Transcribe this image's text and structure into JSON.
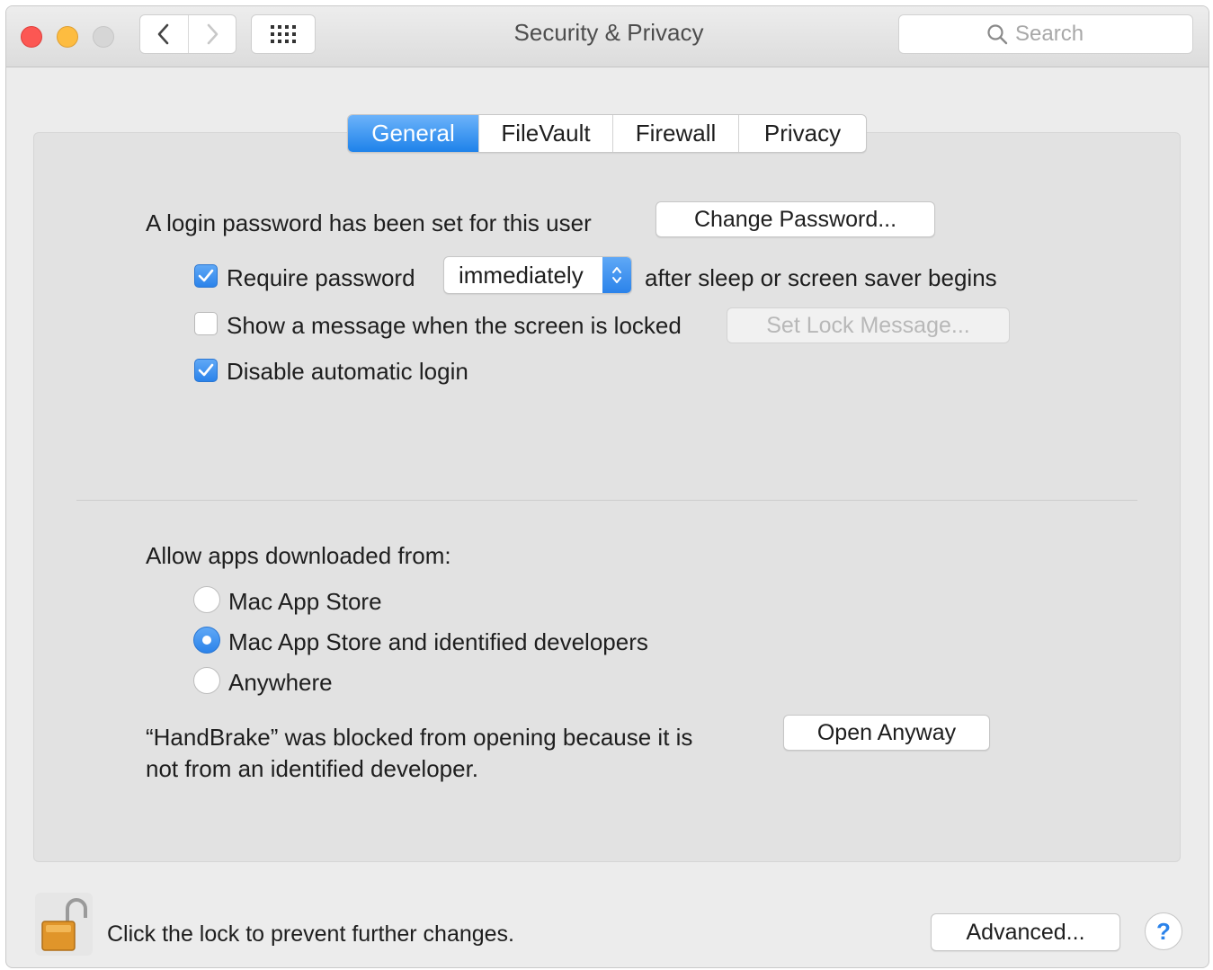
{
  "window": {
    "title": "Security & Privacy",
    "search_placeholder": "Search"
  },
  "tabs": [
    {
      "label": "General",
      "selected": true
    },
    {
      "label": "FileVault",
      "selected": false
    },
    {
      "label": "Firewall",
      "selected": false
    },
    {
      "label": "Privacy",
      "selected": false
    }
  ],
  "general": {
    "login_password_text": "A login password has been set for this user",
    "change_password_label": "Change Password...",
    "require_password": {
      "label": "Require password",
      "checked": true
    },
    "require_password_delay": "immediately",
    "after_sleep_text": "after sleep or screen saver begins",
    "show_message": {
      "label": "Show a message when the screen is locked",
      "checked": false
    },
    "set_lock_message_label": "Set Lock Message...",
    "disable_auto_login": {
      "label": "Disable automatic login",
      "checked": true
    }
  },
  "gatekeeper": {
    "heading": "Allow apps downloaded from:",
    "options": [
      {
        "label": "Mac App Store",
        "selected": false
      },
      {
        "label": "Mac App Store and identified developers",
        "selected": true
      },
      {
        "label": "Anywhere",
        "selected": false
      }
    ],
    "blocked_line1": "“HandBrake” was blocked from opening because it is",
    "blocked_line2": "not from an identified developer.",
    "open_anyway_label": "Open Anyway"
  },
  "footer": {
    "lock_text": "Click the lock to prevent further changes.",
    "advanced_label": "Advanced...",
    "help_label": "?"
  },
  "colors": {
    "accent": "#2b83ea",
    "close": "#fc5753",
    "minimize": "#fdbc40",
    "lock_body": "#e0952a"
  },
  "icons": [
    "chevron-left-icon",
    "chevron-right-icon",
    "grid-icon",
    "search-icon",
    "checkmark-icon",
    "stepper-arrows-icon",
    "padlock-open-icon",
    "help-icon"
  ]
}
